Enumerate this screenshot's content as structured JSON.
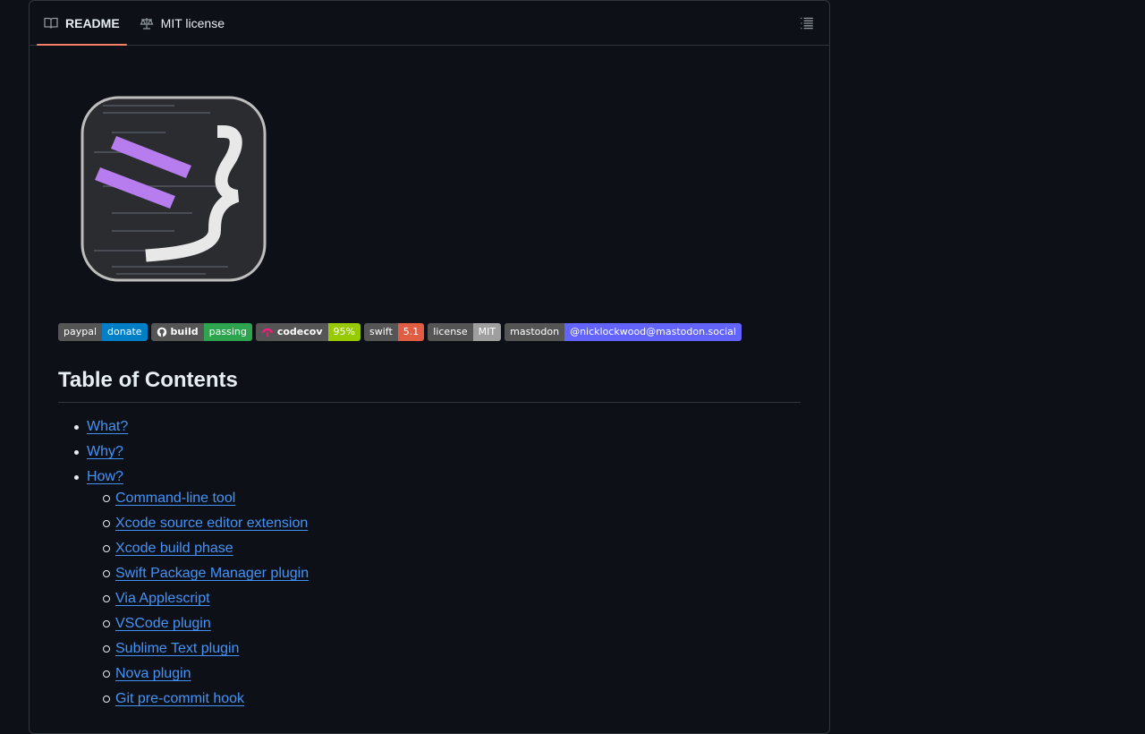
{
  "tabs": [
    {
      "label": "README",
      "icon": "book-icon",
      "active": true
    },
    {
      "label": "MIT license",
      "icon": "law-scale-icon",
      "active": false
    }
  ],
  "badges": [
    {
      "left": "paypal",
      "right": "donate",
      "color": "#007ec6"
    },
    {
      "left": "build",
      "right": "passing",
      "color": "#2ea44f",
      "icon": "github-icon"
    },
    {
      "left": "codecov",
      "right": "95%",
      "color": "#97ca00",
      "icon": "codecov-icon"
    },
    {
      "left": "swift",
      "right": "5.1",
      "color": "#e05d44"
    },
    {
      "left": "license",
      "right": "MIT",
      "color": "#9f9f9f"
    },
    {
      "left": "mastodon",
      "right": "@nicklockwood@mastodon.social",
      "color": "#6364ff"
    }
  ],
  "heading": "Table of Contents",
  "toc": [
    {
      "label": "What?",
      "level": 1
    },
    {
      "label": "Why?",
      "level": 1
    },
    {
      "label": "How?",
      "level": 1
    },
    {
      "label": "Command-line tool",
      "level": 2
    },
    {
      "label": "Xcode source editor extension",
      "level": 2
    },
    {
      "label": "Xcode build phase",
      "level": 2
    },
    {
      "label": "Swift Package Manager plugin",
      "level": 2
    },
    {
      "label": "Via Applescript",
      "level": 2
    },
    {
      "label": "VSCode plugin",
      "level": 2
    },
    {
      "label": "Sublime Text plugin",
      "level": 2
    },
    {
      "label": "Nova plugin",
      "level": 2
    },
    {
      "label": "Git pre-commit hook",
      "level": 2
    }
  ]
}
